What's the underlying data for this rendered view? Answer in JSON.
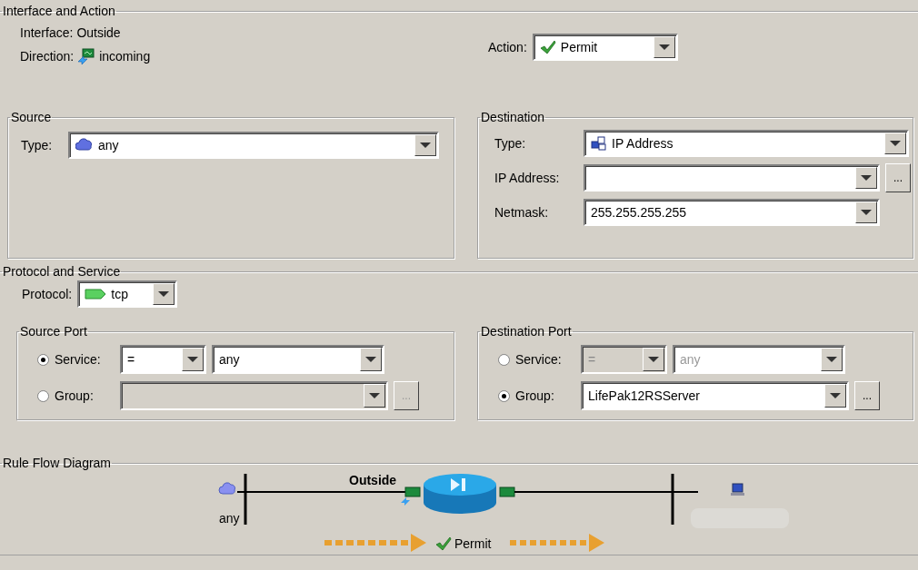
{
  "interface_action": {
    "title": "Interface and Action",
    "interface_label": "Interface:",
    "interface_value": "Outside",
    "direction_label": "Direction:",
    "direction_value": "incoming",
    "action": {
      "label": "Action:",
      "value": "Permit"
    }
  },
  "source": {
    "title": "Source",
    "type": {
      "label": "Type:",
      "value": "any"
    }
  },
  "destination": {
    "title": "Destination",
    "fields": [
      {
        "kind": "icon-combo",
        "label": "Type:",
        "value": "IP Address"
      },
      {
        "kind": "browse-combo",
        "label": "IP Address:",
        "browse": "..."
      },
      {
        "kind": "combo",
        "label": "Netmask:",
        "value": "255.255.255.255"
      }
    ]
  },
  "protocol_service": {
    "title": "Protocol and Service",
    "protocol": {
      "label": "Protocol:",
      "value": "tcp"
    },
    "ports": [
      {
        "title": "Source Port",
        "options": [
          {
            "kind": "service",
            "label": "Service:",
            "selected": true,
            "disabled": false,
            "operator": "=",
            "value": "any"
          },
          {
            "kind": "group",
            "label": "Group:",
            "selected": false,
            "disabled": true,
            "browse": "..."
          }
        ]
      },
      {
        "title": "Destination Port",
        "options": [
          {
            "kind": "service",
            "label": "Service:",
            "selected": false,
            "disabled": true,
            "operator": "=",
            "value": "any"
          },
          {
            "kind": "group",
            "label": "Group:",
            "selected": true,
            "disabled": false,
            "value": "LifePak12RSServer",
            "browse": "..."
          }
        ]
      }
    ]
  },
  "diagram": {
    "title": "Rule Flow Diagram",
    "interface_label": "Outside",
    "source_label": "any",
    "action": "Permit"
  }
}
